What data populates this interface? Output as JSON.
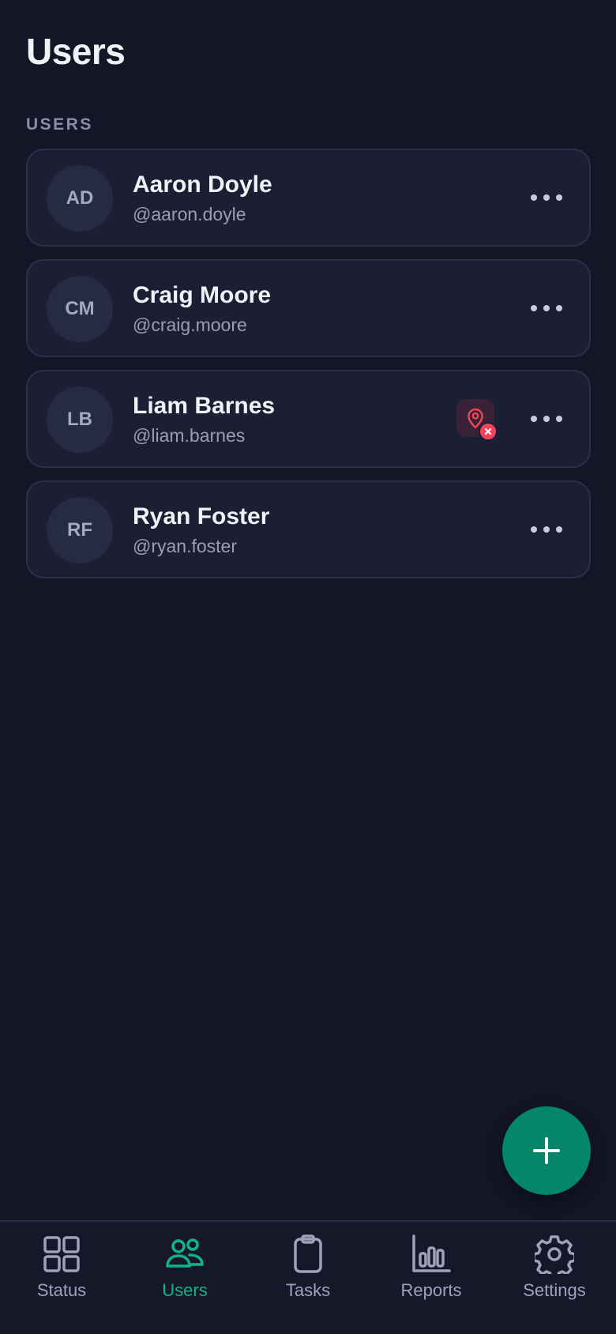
{
  "header": {
    "title": "Users"
  },
  "section_label": "USERS",
  "users": [
    {
      "initials": "AD",
      "name": "Aaron Doyle",
      "handle": "@aaron.doyle",
      "location_off": false
    },
    {
      "initials": "CM",
      "name": "Craig Moore",
      "handle": "@craig.moore",
      "location_off": false
    },
    {
      "initials": "LB",
      "name": "Liam Barnes",
      "handle": "@liam.barnes",
      "location_off": true
    },
    {
      "initials": "RF",
      "name": "Ryan Foster",
      "handle": "@ryan.foster",
      "location_off": false
    }
  ],
  "fab": {
    "icon": "plus-icon"
  },
  "bottom_nav": {
    "items": [
      {
        "label": "Status",
        "icon": "grid-icon",
        "active": false
      },
      {
        "label": "Users",
        "icon": "users-icon",
        "active": true
      },
      {
        "label": "Tasks",
        "icon": "clipboard-icon",
        "active": false
      },
      {
        "label": "Reports",
        "icon": "bar-chart-icon",
        "active": false
      },
      {
        "label": "Settings",
        "icon": "gear-icon",
        "active": false
      }
    ]
  },
  "colors": {
    "background": "#141628",
    "card": "#1c1e33",
    "accent": "#10b586",
    "fab": "#05866a",
    "alert": "#f2445c"
  }
}
